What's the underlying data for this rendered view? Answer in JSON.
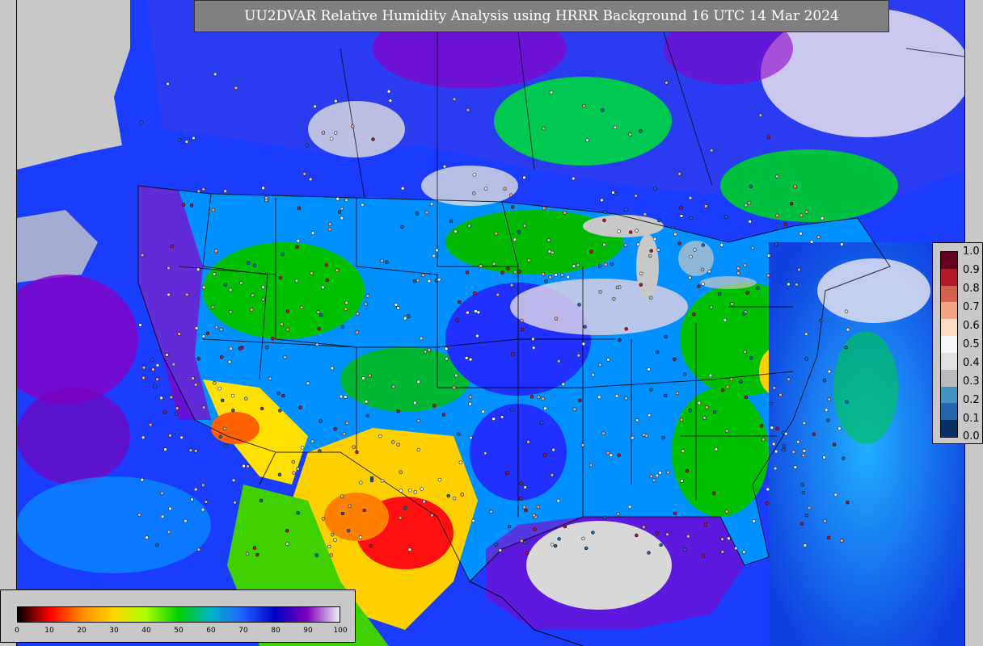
{
  "title": "UU2DVAR Relative Humidity Analysis using HRRR Background 16 UTC 14 Mar 2024",
  "rh_colorbar": {
    "ticks": [
      "0",
      "10",
      "20",
      "30",
      "40",
      "50",
      "60",
      "70",
      "80",
      "90",
      "100"
    ],
    "colors": [
      "#000000",
      "#ff0000",
      "#ff8c00",
      "#ffd700",
      "#aaff00",
      "#00d000",
      "#00b4c8",
      "#2060ff",
      "#0000c0",
      "#8000c0",
      "#f0f0f0"
    ]
  },
  "obs_colorbar": {
    "ticks": [
      "1.0",
      "0.9",
      "0.8",
      "0.7",
      "0.6",
      "0.5",
      "0.4",
      "0.3",
      "0.2",
      "0.1",
      "0.0"
    ],
    "colors": [
      "#67001f",
      "#b2182b",
      "#d6604d",
      "#f4a582",
      "#fddbc7",
      "#f7f7f7",
      "#e0e0e0",
      "#bababa",
      "#4393c3",
      "#2166ac",
      "#053061"
    ]
  },
  "map": {
    "ocean_color": "#1040e0",
    "land_colors": [
      "#00c000",
      "#0090ff",
      "#2040ff",
      "#8000c0",
      "#ffe000",
      "#ff0000"
    ]
  }
}
